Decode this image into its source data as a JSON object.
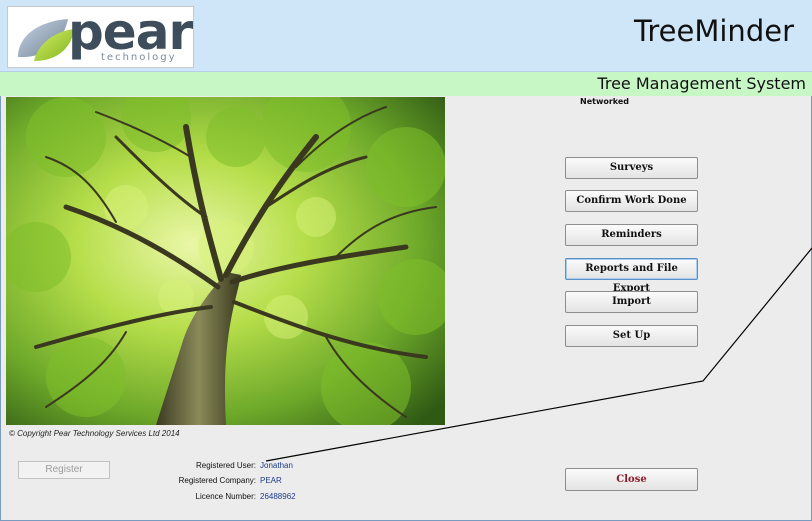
{
  "header": {
    "logo_text": "pear",
    "logo_sub": "technology",
    "app_title": "TreeMinder",
    "app_subtitle": "Tree Management System"
  },
  "status": {
    "mode": "Networked"
  },
  "copyright": "© Copyright Pear Technology Services Ltd 2014",
  "menu": {
    "surveys": "Surveys",
    "confirm_work_done": "Confirm Work Done",
    "reminders": "Reminders",
    "reports": "Reports and File Export",
    "import": "Import",
    "setup": "Set Up"
  },
  "registration": {
    "register_button": "Register",
    "user_label": "Registered User:",
    "user_value": "Jonathan",
    "company_label": "Registered Company:",
    "company_value": "PEAR",
    "licence_label": "Licence Number:",
    "licence_value": "26488962"
  },
  "close_button": "Close",
  "colors": {
    "header_bg": "#cfe6f8",
    "subheader_bg": "#c8f7c6",
    "close_text": "#8a1b2c",
    "value_text": "#1e3c8c"
  }
}
